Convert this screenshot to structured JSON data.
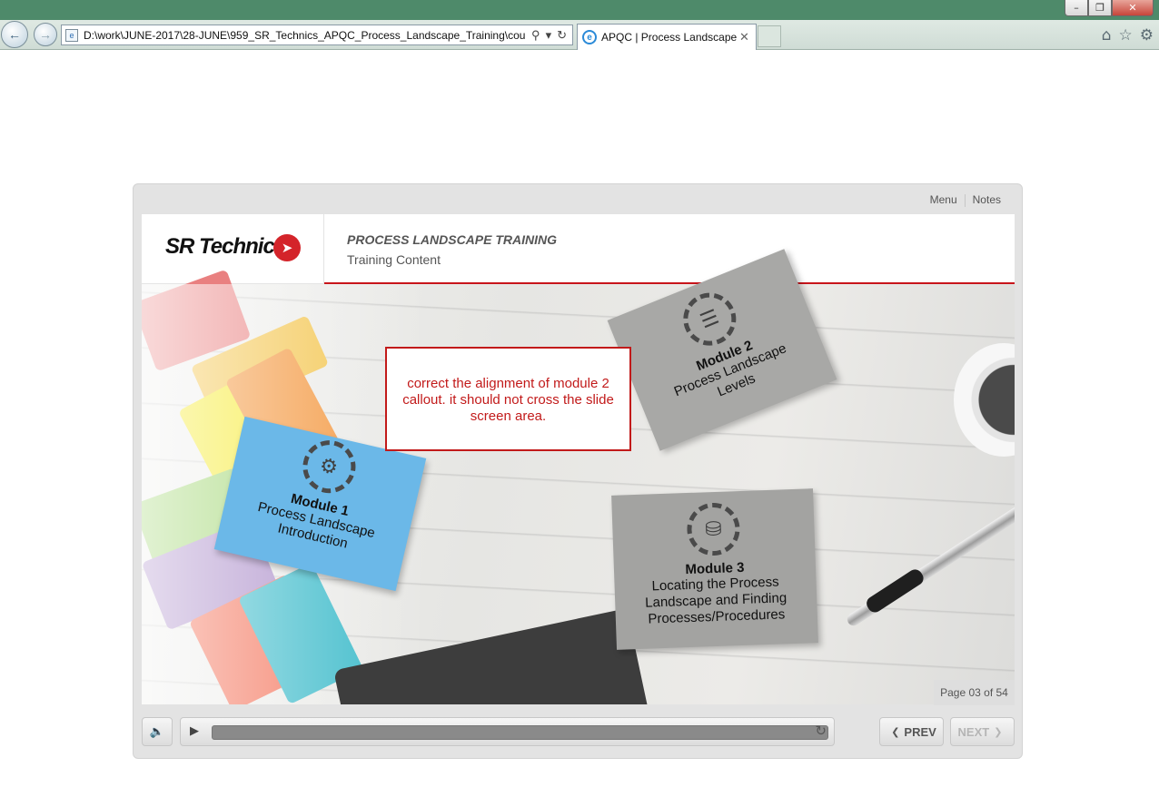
{
  "browser": {
    "address_url": "D:\\work\\JUNE-2017\\28-JUNE\\959_SR_Technics_APQC_Process_Landscape_Training\\course\\",
    "tab_title": "APQC | Process Landscape ...",
    "icons": [
      "back-icon",
      "forward-icon",
      "search-icon",
      "refresh-icon",
      "home-icon",
      "star-icon",
      "gear-icon"
    ]
  },
  "player": {
    "menu_label": "Menu",
    "notes_label": "Notes",
    "page_indicator": "Page 03 of 54",
    "prev_label": "PREV",
    "next_label": "NEXT"
  },
  "slide": {
    "logo_text": "SR Technics",
    "course_title": "PROCESS LANDSCAPE TRAINING",
    "course_subtitle": "Training Content",
    "callout_text": "correct the alignment of module 2 callout. it should not cross the slide screen area.",
    "modules": [
      {
        "title": "Module 1",
        "desc_lines": [
          "Process Landscape",
          "Introduction"
        ],
        "color": "#6bb8e8"
      },
      {
        "title": "Module 2",
        "desc_lines": [
          "Process Landscape",
          "Levels"
        ],
        "color": "#a8a8a6"
      },
      {
        "title": "Module 3",
        "desc_lines": [
          "Locating the Process",
          "Landscape and Finding",
          "Processes/Procedures"
        ],
        "color": "#a3a3a1"
      }
    ]
  },
  "colors": {
    "accent_red": "#c8151b",
    "callout_red": "#c21a1a"
  }
}
